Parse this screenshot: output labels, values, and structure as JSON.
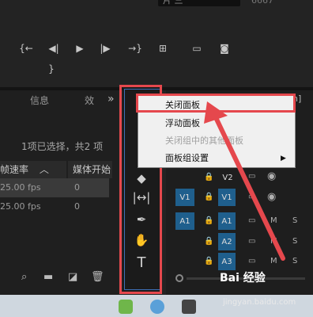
{
  "top": {
    "timecode_field": "片 三",
    "timecode_right": "6667",
    "transport_icons": [
      "mark-in-icon",
      "step-back-icon",
      "play-icon",
      "step-forward-icon",
      "mark-out-icon",
      "lift-icon",
      "extract-icon",
      "export-frame-icon"
    ]
  },
  "project_panel": {
    "tabs": [
      "信息",
      "效"
    ],
    "overflow": "»",
    "selection_info": "1项已选择，共2 项",
    "columns": [
      "帧速率",
      "媒体开始"
    ],
    "rows": [
      {
        "fps": "25.00 fps",
        "start": "0"
      },
      {
        "fps": "25.00 fps",
        "start": "0"
      }
    ]
  },
  "tools": [
    "track-select-icon",
    "ripple-icon",
    "razor-icon",
    "slip-icon",
    "pen-icon",
    "hand-icon",
    "type-icon"
  ],
  "context_menu": {
    "items": [
      {
        "label": "关闭面板",
        "enabled": true
      },
      {
        "label": "浮动面板",
        "enabled": true
      },
      {
        "label": "关闭组中的其他面板",
        "enabled": false
      },
      {
        "label": "面板组设置",
        "enabled": true,
        "submenu": true
      }
    ]
  },
  "timeline": {
    "video_tracks": [
      {
        "name": "V2"
      },
      {
        "name": "V1",
        "source": "V1"
      }
    ],
    "audio_tracks": [
      {
        "name": "A1",
        "source": "A1"
      },
      {
        "name": "A2"
      },
      {
        "name": "A3"
      }
    ],
    "mute": "M",
    "solo": "S",
    "header_text": "n]"
  },
  "watermark": {
    "brand": "Bai 经验",
    "url": "jingyan.baidu.com"
  },
  "colors": {
    "accent_red": "#e5484d",
    "track_blue": "#1f5f8d",
    "panel_dark": "#1f1f1f"
  }
}
